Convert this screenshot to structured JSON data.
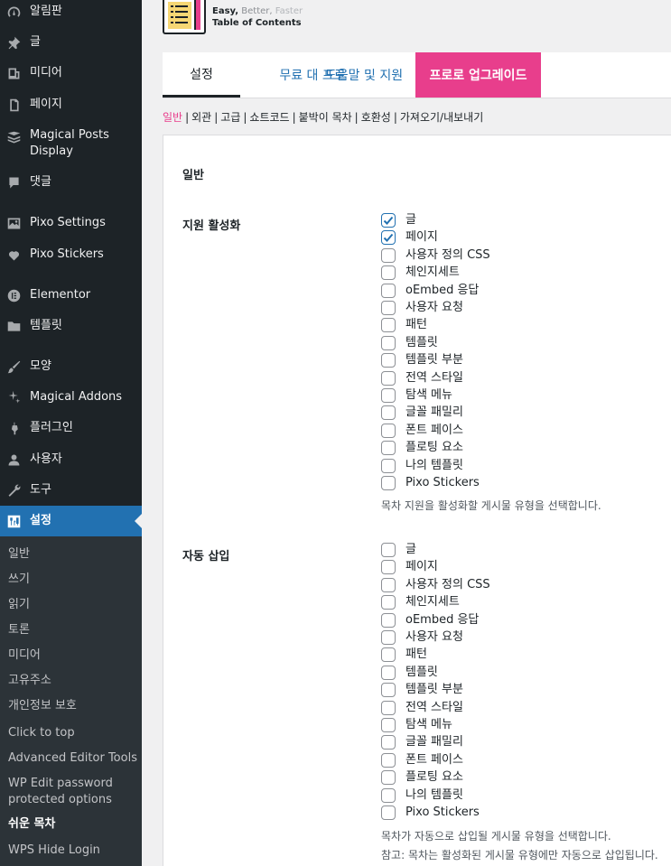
{
  "sidebar": {
    "items": [
      {
        "label": "알림판",
        "icon": "dashboard-icon"
      },
      {
        "label": "글",
        "icon": "pin-icon"
      },
      {
        "label": "미디어",
        "icon": "media-icon"
      },
      {
        "label": "페이지",
        "icon": "page-icon"
      },
      {
        "label": "Magical Posts",
        "label2": "Display",
        "icon": "posts-display-icon"
      },
      {
        "label": "댓글",
        "icon": "comment-icon"
      },
      {
        "label": "Pixo Settings",
        "icon": "image-icon"
      },
      {
        "label": "Pixo Stickers",
        "icon": "heart-icon"
      },
      {
        "label": "Elementor",
        "icon": "elementor-icon"
      },
      {
        "label": "템플릿",
        "icon": "folder-icon"
      },
      {
        "label": "모양",
        "icon": "brush-icon"
      },
      {
        "label": "Magical Addons",
        "icon": "sparkle-icon"
      },
      {
        "label": "플러그인",
        "icon": "plugin-icon"
      },
      {
        "label": "사용자",
        "icon": "user-icon"
      },
      {
        "label": "도구",
        "icon": "wrench-icon"
      },
      {
        "label": "설정",
        "icon": "settings-icon"
      }
    ],
    "submenu": [
      "일반",
      "쓰기",
      "읽기",
      "토론",
      "미디어",
      "고유주소",
      "개인정보 보호",
      "Click to top",
      "Advanced Editor Tools",
      "WP Edit password",
      "protected options",
      "쉬운 목차",
      "WPS Hide Login"
    ]
  },
  "header": {
    "tagline_1": "Easy,",
    "tagline_2": "Better,",
    "tagline_3": "Faster",
    "tagline_sub": "Table of Contents"
  },
  "tabs": [
    "설정",
    "무료 대 프로",
    "도움말 및 지원",
    "프로로 업그레이드"
  ],
  "subnav": [
    "일반",
    "외관",
    "고급",
    "쇼트코드",
    "붙박이 목차",
    "호환성",
    "가져오기/내보내기"
  ],
  "section": {
    "title": "일반",
    "support": {
      "label": "지원 활성화",
      "options": [
        {
          "label": "글",
          "checked": true
        },
        {
          "label": "페이지",
          "checked": true
        },
        {
          "label": "사용자 정의 CSS",
          "checked": false
        },
        {
          "label": "체인지세트",
          "checked": false
        },
        {
          "label": "oEmbed 응답",
          "checked": false
        },
        {
          "label": "사용자 요청",
          "checked": false
        },
        {
          "label": "패턴",
          "checked": false
        },
        {
          "label": "템플릿",
          "checked": false
        },
        {
          "label": "템플릿 부분",
          "checked": false
        },
        {
          "label": "전역 스타일",
          "checked": false
        },
        {
          "label": "탐색 메뉴",
          "checked": false
        },
        {
          "label": "글꼴 패밀리",
          "checked": false
        },
        {
          "label": "폰트 페이스",
          "checked": false
        },
        {
          "label": "플로팅 요소",
          "checked": false
        },
        {
          "label": "나의 템플릿",
          "checked": false
        },
        {
          "label": "Pixo Stickers",
          "checked": false
        }
      ],
      "help": "목차 지원을 활성화할 게시물 유형을 선택합니다."
    },
    "auto": {
      "label": "자동 삽입",
      "options": [
        {
          "label": "글",
          "checked": false
        },
        {
          "label": "페이지",
          "checked": false
        },
        {
          "label": "사용자 정의 CSS",
          "checked": false
        },
        {
          "label": "체인지세트",
          "checked": false
        },
        {
          "label": "oEmbed 응답",
          "checked": false
        },
        {
          "label": "사용자 요청",
          "checked": false
        },
        {
          "label": "패턴",
          "checked": false
        },
        {
          "label": "템플릿",
          "checked": false
        },
        {
          "label": "템플릿 부분",
          "checked": false
        },
        {
          "label": "전역 스타일",
          "checked": false
        },
        {
          "label": "탐색 메뉴",
          "checked": false
        },
        {
          "label": "글꼴 패밀리",
          "checked": false
        },
        {
          "label": "폰트 페이스",
          "checked": false
        },
        {
          "label": "플로팅 요소",
          "checked": false
        },
        {
          "label": "나의 템플릿",
          "checked": false
        },
        {
          "label": "Pixo Stickers",
          "checked": false
        }
      ],
      "help": "목차가 자동으로 삽입될 게시물 유형을 선택합니다.",
      "note": "참고: 목차는 활성화된 게시물 유형에만 자동으로 삽입됩니다."
    }
  },
  "colors": {
    "sidebar_bg": "#1d2327",
    "active": "#2271b1",
    "accent": "#e83e8c"
  }
}
